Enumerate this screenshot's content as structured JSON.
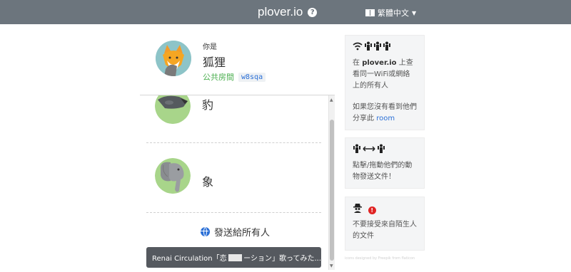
{
  "navbar": {
    "brand": "plover.io",
    "help_icon_glyph": "?",
    "language": "繁體中文",
    "language_icon": "language-book-icon",
    "caret_glyph": "▼"
  },
  "me": {
    "you_are": "你是",
    "name": "狐狸",
    "room_label": "公共房間",
    "room_code": "w8sqa",
    "avatar_icon": "fox-avatar"
  },
  "peers": [
    {
      "name": "豹",
      "avatar_icon": "leopard-avatar"
    },
    {
      "name": "象",
      "avatar_icon": "elephant-avatar"
    }
  ],
  "send_all": {
    "label": "發送給所有人",
    "icon": "globe-icon"
  },
  "toast": {
    "text_before": "Renai Circulation「恋",
    "text_after": "ーション」歌ってみた..."
  },
  "cards": {
    "wifi": {
      "icons": "wifi-people-icon",
      "line1_prefix": "在 ",
      "line1_bold": "plover.io",
      "line1_suffix": " 上查看同一WiFi或網絡上的所有人",
      "line2_prefix": "如果您沒有看到他們分享此 ",
      "line2_link": "room"
    },
    "drag": {
      "icons": "person-exchange-icon",
      "text": "點擊/拖動他們的動物發送文件！"
    },
    "warning": {
      "icons": "spy-warning-icon",
      "warn_glyph": "!",
      "text": "不要接受來自陌生人的文件"
    }
  },
  "footer": {
    "note": "icons designed by Freepik from flaticon"
  },
  "colors": {
    "navbar": "#6c757d",
    "room_label": "#4caf50",
    "link": "#2a6fd6",
    "warn": "#e02424",
    "toast": "#55595f"
  }
}
